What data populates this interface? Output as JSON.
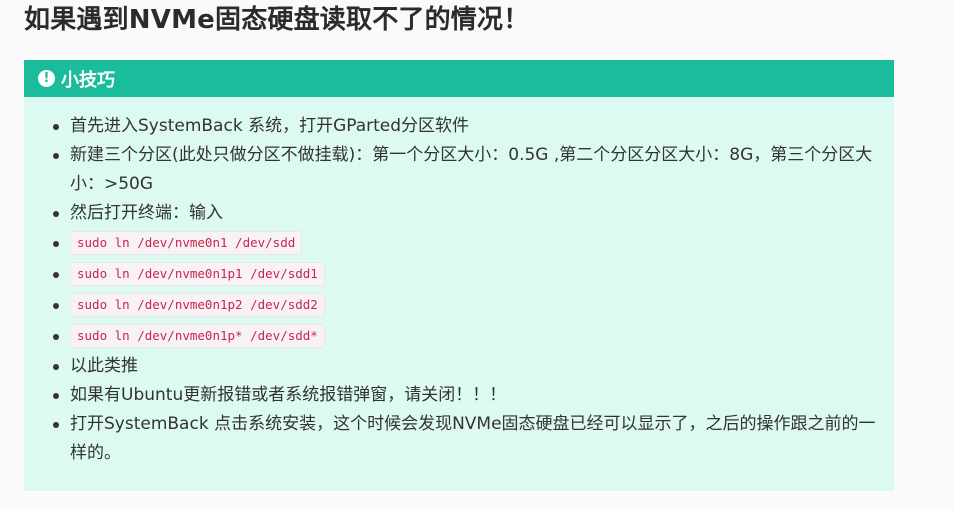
{
  "page": {
    "title": "如果遇到NVMe固态硬盘读取不了的情况！"
  },
  "tip": {
    "icon_glyph": "!",
    "icon_name": "exclamation-circle-icon",
    "header": "小技巧",
    "items": [
      "首先进入SystemBack 系统，打开GParted分区软件",
      "新建三个分区(此处只做分区不做挂载)：第一个分区大小：0.5G ,第二个分区分区大小：8G，第三个分区大小：>50G",
      "然后打开终端：输入",
      "sudo ln /dev/nvme0n1 /dev/sdd",
      "sudo ln /dev/nvme0n1p1 /dev/sdd1",
      "sudo ln /dev/nvme0n1p2 /dev/sdd2",
      "sudo ln /dev/nvme0n1p* /dev/sdd*",
      "以此类推",
      "如果有Ubuntu更新报错或者系统报错弹窗，请关闭！！！",
      "打开SystemBack 点击系统安装，这个时候会发现NVMe固态硬盘已经可以显示了，之后的操作跟之前的一样的。"
    ]
  },
  "colors": {
    "header_bg": "#1abc9c",
    "box_bg": "#dcfaf2",
    "code_text": "#c7254e"
  }
}
